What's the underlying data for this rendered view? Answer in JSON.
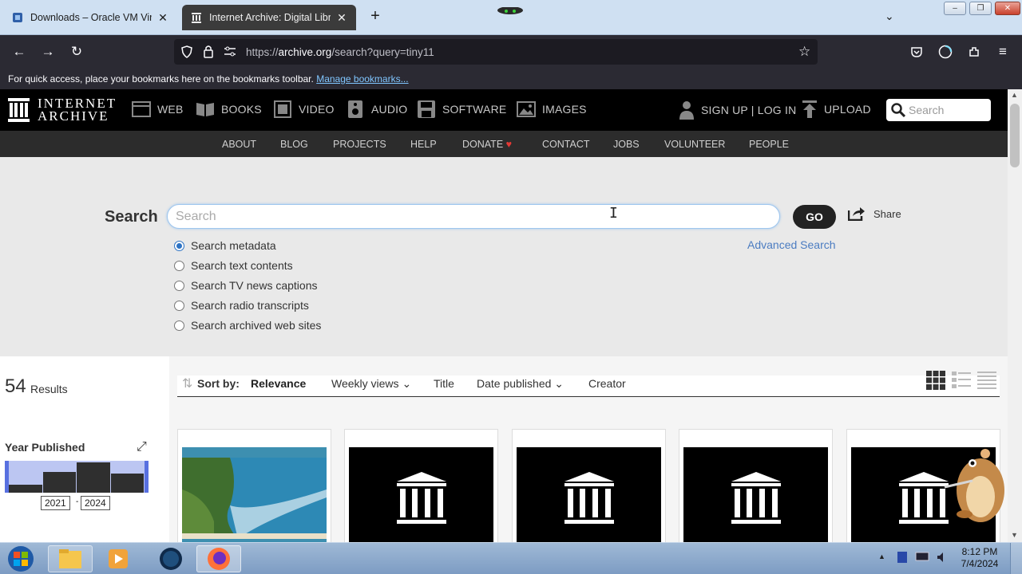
{
  "browser": {
    "tabs": [
      {
        "title": "Downloads – Oracle VM VirtualBox",
        "active": false
      },
      {
        "title": "Internet Archive: Digital Library",
        "active": true
      }
    ],
    "url_prefix": "https://",
    "url_host": "archive.org",
    "url_rest": "/search?query=tiny11",
    "bookmarks_text": "For quick access, place your bookmarks here on the bookmarks toolbar.",
    "bookmarks_link": "Manage bookmarks..."
  },
  "ia_header": {
    "logo_line1": "INTERNET",
    "logo_line2": "ARCHIVE",
    "media": [
      {
        "label": "WEB",
        "icon": "web-icon"
      },
      {
        "label": "BOOKS",
        "icon": "book-icon"
      },
      {
        "label": "VIDEO",
        "icon": "film-icon"
      },
      {
        "label": "AUDIO",
        "icon": "speaker-icon"
      },
      {
        "label": "SOFTWARE",
        "icon": "floppy-icon"
      },
      {
        "label": "IMAGES",
        "icon": "image-icon"
      }
    ],
    "account": "SIGN UP | LOG IN",
    "upload": "UPLOAD",
    "search_placeholder": "Search"
  },
  "ia_nav": [
    "ABOUT",
    "BLOG",
    "PROJECTS",
    "HELP",
    "DONATE",
    "CONTACT",
    "JOBS",
    "VOLUNTEER",
    "PEOPLE"
  ],
  "search": {
    "label": "Search",
    "placeholder": "Search",
    "go": "GO",
    "share": "Share",
    "advanced": "Advanced Search",
    "options": [
      {
        "label": "Search metadata",
        "checked": true
      },
      {
        "label": "Search text contents",
        "checked": false
      },
      {
        "label": "Search TV news captions",
        "checked": false
      },
      {
        "label": "Search radio transcripts",
        "checked": false
      },
      {
        "label": "Search archived web sites",
        "checked": false
      }
    ]
  },
  "results": {
    "count": "54",
    "count_label": "Results",
    "facet_title": "Year Published",
    "year_from": "2021",
    "year_to": "2024",
    "year_bars": [
      0.25,
      0.65,
      0.95,
      0.6
    ],
    "sort_label": "Sort by:",
    "sort_options": [
      "Relevance",
      "Weekly views",
      "Title",
      "Date published",
      "Creator"
    ]
  },
  "taskbar": {
    "time": "8:12 PM",
    "date": "7/4/2024"
  },
  "colors": {
    "accent_link": "#4b7cc1",
    "radio_checked": "#2d73c4",
    "histogram_fill": "#bcc6f2"
  }
}
